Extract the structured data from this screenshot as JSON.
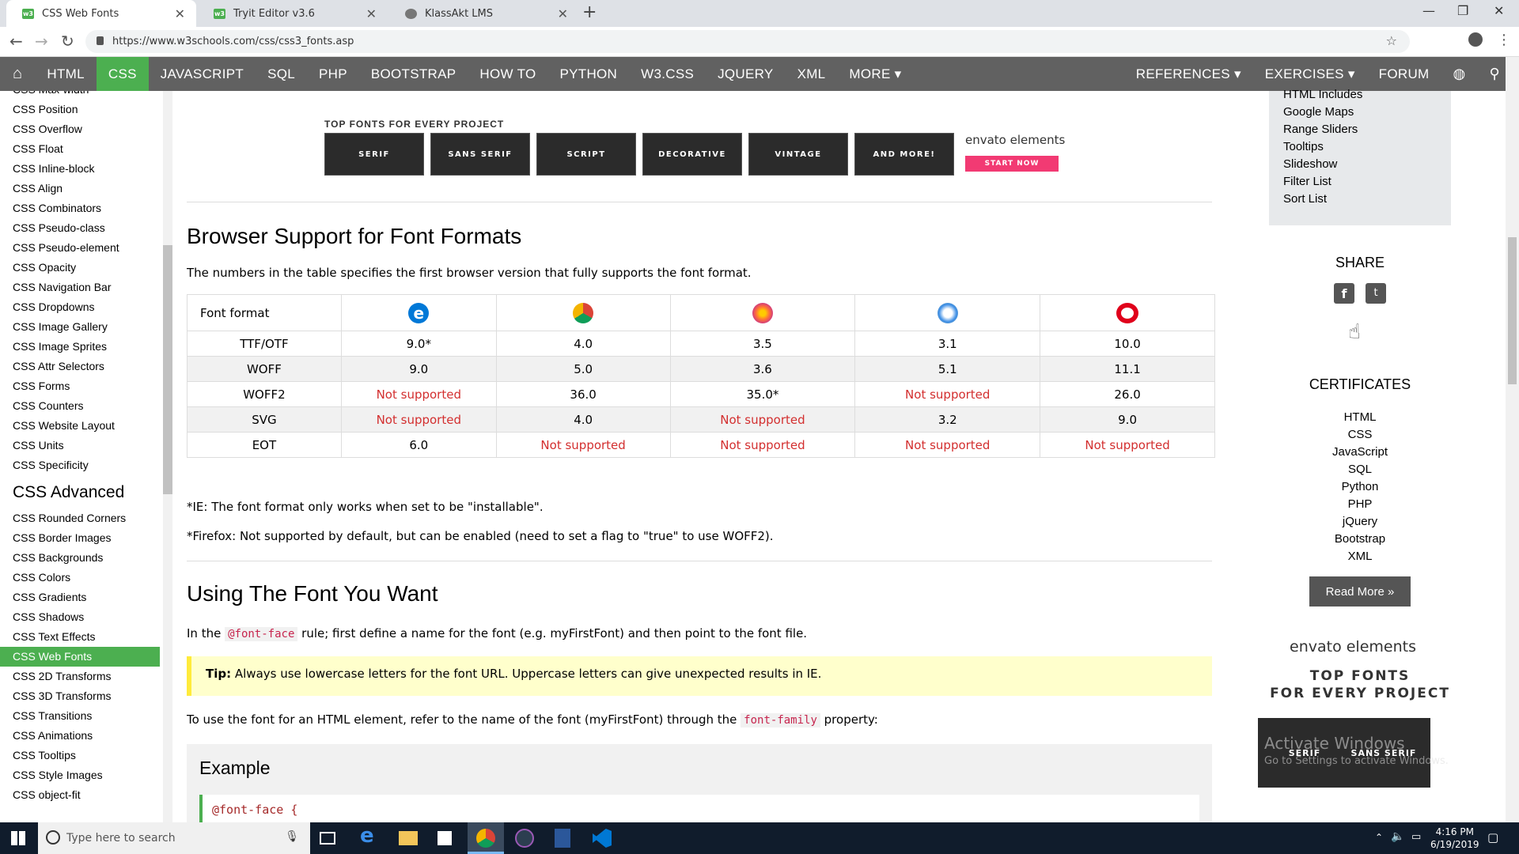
{
  "browser": {
    "tabs": [
      {
        "title": "CSS Web Fonts",
        "active": true,
        "favicon": "w3schools-icon"
      },
      {
        "title": "Tryit Editor v3.6",
        "active": false,
        "favicon": "w3schools-icon"
      },
      {
        "title": "KlassAkt LMS",
        "active": false,
        "favicon": "globe-icon"
      }
    ],
    "url": "https://www.w3schools.com/css/css3_fonts.asp"
  },
  "topnav": {
    "items": [
      "HTML",
      "CSS",
      "JAVASCRIPT",
      "SQL",
      "PHP",
      "BOOTSTRAP",
      "HOW TO",
      "PYTHON",
      "W3.CSS",
      "JQUERY",
      "XML",
      "MORE ▾"
    ],
    "active": "CSS",
    "right": [
      "REFERENCES ▾",
      "EXERCISES ▾",
      "FORUM"
    ]
  },
  "sidebar": {
    "items": [
      "CSS Max-width",
      "CSS Position",
      "CSS Overflow",
      "CSS Float",
      "CSS Inline-block",
      "CSS Align",
      "CSS Combinators",
      "CSS Pseudo-class",
      "CSS Pseudo-element",
      "CSS Opacity",
      "CSS Navigation Bar",
      "CSS Dropdowns",
      "CSS Image Gallery",
      "CSS Image Sprites",
      "CSS Attr Selectors",
      "CSS Forms",
      "CSS Counters",
      "CSS Website Layout",
      "CSS Units",
      "CSS Specificity"
    ],
    "advanced_heading": "CSS Advanced",
    "advanced_items": [
      "CSS Rounded Corners",
      "CSS Border Images",
      "CSS Backgrounds",
      "CSS Colors",
      "CSS Gradients",
      "CSS Shadows",
      "CSS Text Effects",
      "CSS Web Fonts",
      "CSS 2D Transforms",
      "CSS 3D Transforms",
      "CSS Transitions",
      "CSS Animations",
      "CSS Tooltips",
      "CSS Style Images",
      "CSS object-fit"
    ],
    "active": "CSS Web Fonts"
  },
  "ad": {
    "title": "TOP FONTS FOR EVERY PROJECT",
    "tiles": [
      "SERIF",
      "SANS SERIF",
      "SCRIPT",
      "DECORATIVE",
      "VINTAGE",
      "AND MORE!"
    ],
    "logo": "envato elements",
    "button": "START NOW"
  },
  "content": {
    "heading1": "Browser Support for Font Formats",
    "intro": "The numbers in the table specifies the first browser version that fully supports the font format.",
    "table": {
      "header": "Font format",
      "browsers": [
        "edge-icon",
        "chrome-icon",
        "firefox-icon",
        "safari-icon",
        "opera-icon"
      ],
      "rows": [
        {
          "format": "TTF/OTF",
          "values": [
            "9.0*",
            "4.0",
            "3.5",
            "3.1",
            "10.0"
          ]
        },
        {
          "format": "WOFF",
          "values": [
            "9.0",
            "5.0",
            "3.6",
            "5.1",
            "11.1"
          ]
        },
        {
          "format": "WOFF2",
          "values": [
            "Not supported",
            "36.0",
            "35.0*",
            "Not supported",
            "26.0"
          ]
        },
        {
          "format": "SVG",
          "values": [
            "Not supported",
            "4.0",
            "Not supported",
            "3.2",
            "9.0"
          ]
        },
        {
          "format": "EOT",
          "values": [
            "6.0",
            "Not supported",
            "Not supported",
            "Not supported",
            "Not supported"
          ]
        }
      ]
    },
    "note1": "*IE: The font format only works when set to be \"installable\".",
    "note2": "*Firefox: Not supported by default, but can be enabled (need to set a flag to \"true\" to use WOFF2).",
    "heading2": "Using The Font You Want",
    "para1_a": "In the ",
    "para1_code": "@font-face",
    "para1_b": " rule; first define a name for the font (e.g. myFirstFont) and then point to the font file.",
    "tip_label": "Tip:",
    "tip_text": " Always use lowercase letters for the font URL. Uppercase letters can give unexpected results in IE.",
    "para2_a": "To use the font for an HTML element, refer to the name of the font (myFirstFont) through the ",
    "para2_code": "font-family",
    "para2_b": " property:",
    "example_heading": "Example",
    "example_code": "@font-face {"
  },
  "rightcol": {
    "links": [
      "HTML Includes",
      "Google Maps",
      "Range Sliders",
      "Tooltips",
      "Slideshow",
      "Filter List",
      "Sort List"
    ],
    "share": "SHARE",
    "certificates": "CERTIFICATES",
    "cert_items": [
      "HTML",
      "CSS",
      "JavaScript",
      "SQL",
      "Python",
      "PHP",
      "jQuery",
      "Bootstrap",
      "XML"
    ],
    "read_more": "Read More »",
    "ad_logo": "envato elements",
    "ad_title1": "TOP FONTS",
    "ad_title2": "FOR EVERY PROJECT",
    "ad_tiles": [
      "SERIF",
      "SANS SERIF"
    ],
    "watermark1": "Activate Windows",
    "watermark2": "Go to Settings to activate Windows."
  },
  "taskbar": {
    "search_placeholder": "Type here to search",
    "time": "4:16 PM",
    "date": "6/19/2019"
  },
  "colors": {
    "w3green": "#4caf50",
    "nav": "#616161",
    "notsupported": "#d32f2f"
  }
}
